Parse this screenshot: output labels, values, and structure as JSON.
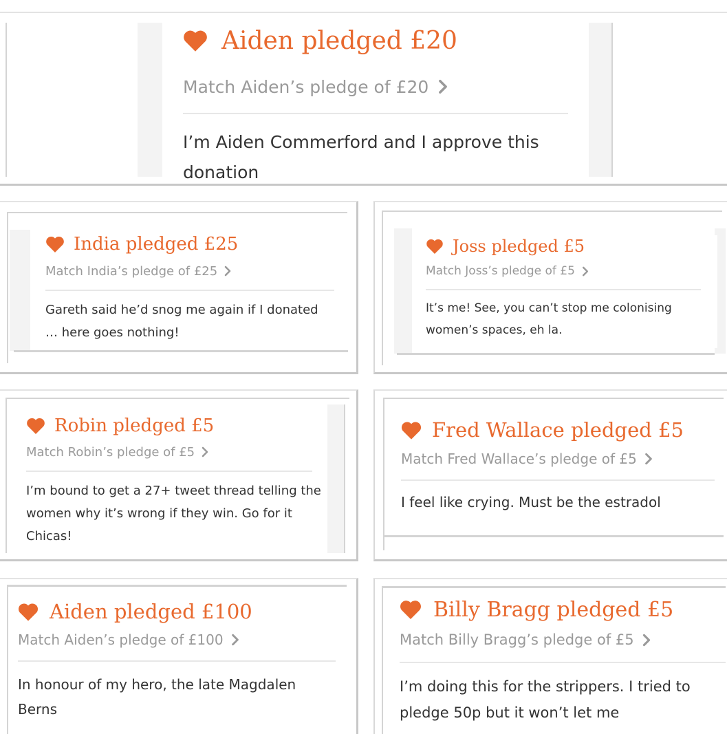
{
  "colors": {
    "accent": "#e8692e",
    "muted": "#9a9a9a",
    "text": "#333333",
    "rule": "#e7e7e7"
  },
  "icons": {
    "heart": "heart-icon",
    "chevron": "chevron-right-icon"
  },
  "pledges": [
    {
      "title": "Aiden pledged £20",
      "match": "Match Aiden’s pledge of £20",
      "message": "I’m Aiden Commerford and I approve this donation"
    },
    {
      "title": "India pledged £25",
      "match": "Match India’s pledge of £25",
      "message": "Gareth said he’d snog me again if I donated … here goes nothing!"
    },
    {
      "title": "Joss pledged £5",
      "match": "Match Joss’s pledge of £5",
      "message": "It’s me! See, you can’t stop me colonising women’s spaces, eh la."
    },
    {
      "title": "Robin pledged £5",
      "match": "Match Robin’s pledge of £5",
      "message": "I’m bound to get a 27+ tweet thread telling the women why it’s wrong if they win. Go for it Chicas!"
    },
    {
      "title": "Fred Wallace pledged £5",
      "match": "Match Fred Wallace’s pledge of £5",
      "message": "I feel like crying. Must be the estradol"
    },
    {
      "title": "Aiden pledged £100",
      "match": "Match Aiden’s pledge of £100",
      "message": "In honour of my hero, the late Magdalen Berns"
    },
    {
      "title": "Billy Bragg pledged £5",
      "match": "Match Billy Bragg’s pledge of £5",
      "message": "I’m doing this for the strippers. I tried to pledge 50p but it won’t let me"
    }
  ]
}
